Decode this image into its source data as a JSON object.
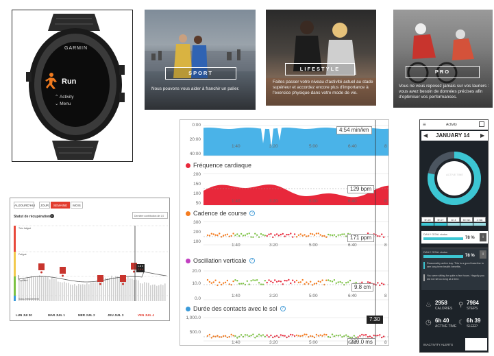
{
  "watch": {
    "brand": "GARMIN",
    "run_label": "Run",
    "menu1": "Activity",
    "menu2": "Menu"
  },
  "banners": [
    {
      "tag": "SPORT",
      "desc": "Nous pouvons vous aider à franchir un palier."
    },
    {
      "tag": "LIFESTYLE",
      "desc": "Faites passer votre niveau d'activité actuel au stade supérieur et accordez encore plus d'importance à l'exercice physique dans votre mode de vie."
    },
    {
      "tag": "PRO",
      "desc": "Vous ne vous reposez jamais sur vos lauriers : vous avez besoin de données précises afin d'optimiser vos performances."
    }
  ],
  "activity": {
    "pace_ticks": [
      "0:00",
      "20:00",
      "40:00"
    ],
    "pace_value": "4:54 min/km",
    "time_ticks": [
      "1:40",
      "3:20",
      "5:00",
      "6:40"
    ],
    "time_edge": "8",
    "hr_title": "Fréquence cardiaque",
    "hr_ticks": [
      "200",
      "150",
      "100",
      "50"
    ],
    "hr_value": "129 bpm",
    "cad_title": "Cadence de course",
    "cad_ticks": [
      "300",
      "200",
      "100"
    ],
    "cad_value": "171 ppm",
    "osc_title": "Oscillation verticale",
    "osc_ticks": [
      "20.0",
      "10.0",
      "0.0"
    ],
    "osc_value": "9.8 cm",
    "gct_title": "Durée des contacts avec le sol",
    "gct_ticks": [
      "1,000.0",
      "500.0"
    ],
    "gct_value": "239.0 ms",
    "time_marker": "7:30",
    "colors": {
      "pace": "#4ab3e8",
      "hr": "#e8283b",
      "cad": "#f57c1f",
      "osc": "#c23fc1",
      "gct": "#3a9ad9"
    }
  },
  "recovery": {
    "tabs": [
      "AUJOURD'HUI",
      "JOUR",
      "SEMAINE",
      "MOIS"
    ],
    "active_tab": "SEMAINE",
    "title": "Statut de récupération",
    "contribution": "Dernière contribution de 1,0",
    "levels": [
      "Très fatigué",
      "Fatigué",
      "Équilibré",
      "Sous-entraînement"
    ],
    "days": [
      "LUN JUI 30",
      "MAR JUIL 1",
      "MER JUIL 2",
      "JEU JUIL 3",
      "VEN JUIL 4"
    ],
    "popup_line1": "1.8 h",
    "popup_line2": "2,6 k"
  },
  "phone": {
    "header": "Activity",
    "date": "JANUARY 14",
    "ring_label": "ACTIVE TIME",
    "ring_value": "6h 40",
    "ring_fraction": 0.78,
    "seg_values": [
      "5h 20",
      "6h 27",
      "4h 4",
      "50 min",
      "2 min"
    ],
    "daily_goal_label": "DAILY GOAL status",
    "daily_goal_pct": "78 %",
    "note1": "Reasonably active day. This is a good baseline to see long term health benefits.",
    "note2": "You were sitting for quite a few hours. Happily you did not sit too long at a time.",
    "calories": "2958",
    "calories_label": "CALORIES",
    "steps": "7984",
    "steps_label": "STEPS",
    "active_time": "6h 40",
    "active_label": "ACTIVE TIME",
    "sleep": "6h 39",
    "sleep_label": "SLEEP",
    "inactivity": "INACTIVITY ALERTS",
    "accent": "#3cc6d3"
  }
}
